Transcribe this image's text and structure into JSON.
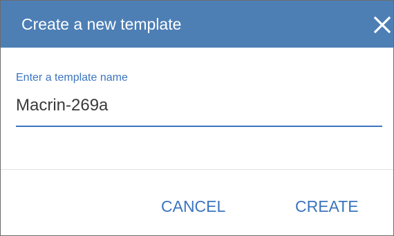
{
  "dialog": {
    "title": "Create a new template",
    "close_icon": "close-icon",
    "header_color": "#4d7fb5",
    "accent_color": "#3a74bf"
  },
  "form": {
    "name_label": "Enter a template name",
    "name_value": "Macrin-269a"
  },
  "actions": {
    "cancel_label": "CANCEL",
    "create_label": "CREATE"
  }
}
